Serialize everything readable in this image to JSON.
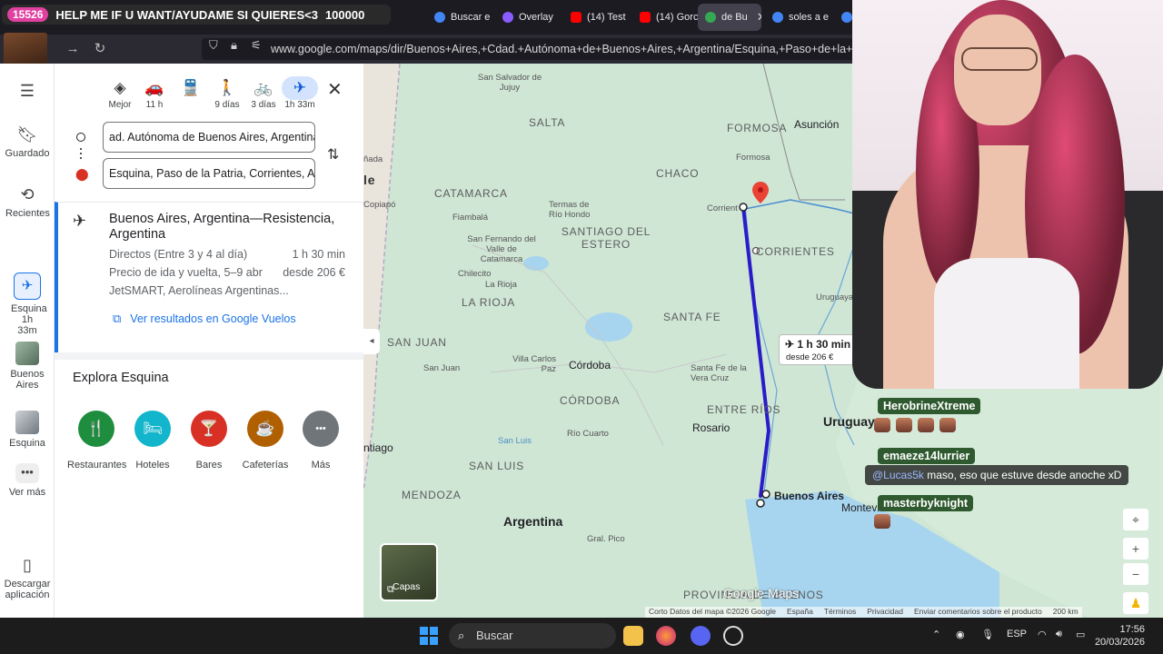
{
  "browser": {
    "tabs": [
      {
        "label": "HELP ME IF U WANT/AYUDAME SI QUIERES<3",
        "color": "#7a5cff"
      },
      {
        "label": "Buscar e",
        "color": "#4285f4"
      },
      {
        "label": "Overlay",
        "color": "#8a5cff"
      },
      {
        "label": "(14) Test",
        "color": "#ff0000"
      },
      {
        "label": "(14) Gorc",
        "color": "#ff0000"
      },
      {
        "label": "de Bu",
        "color": "#34a853"
      },
      {
        "label": "soles a e",
        "color": "#4285f4"
      },
      {
        "label": "cual",
        "color": "#4285f4"
      }
    ],
    "url": "www.google.com/maps/dir/Buenos+Aires,+Cdad.+Autónoma+de+Buenos+Aires,+Argentina/Esquina,+Paso+de+la+Patria,+C"
  },
  "stream": {
    "banner_count": "15526",
    "banner_text": "HELP ME IF U WANT/AYUDAME SI QUIERES<3",
    "goal": "100000",
    "cam_badge": "18"
  },
  "rail": {
    "items": [
      {
        "label": "Guardado",
        "icon": "bookmark-icon"
      },
      {
        "label": "Recientes",
        "icon": "history-icon"
      },
      {
        "label": "Esquina 1h 33m",
        "icon": "airplane-icon"
      },
      {
        "label": "Buenos Aires",
        "icon": "place-thumbnail"
      },
      {
        "label": "Esquina",
        "icon": "place-thumbnail"
      },
      {
        "label": "Ver más",
        "icon": "more-icon"
      },
      {
        "label": "Descargar aplicación",
        "icon": "phone-icon"
      }
    ]
  },
  "directions": {
    "modes": [
      {
        "label": "Mejor",
        "icon": "◈"
      },
      {
        "label": "11 h",
        "icon": "🚗"
      },
      {
        "label": "",
        "icon": "🚆"
      },
      {
        "label": "9 días",
        "icon": "🚶"
      },
      {
        "label": "3 días",
        "icon": "🚲"
      },
      {
        "label": "1h 33m",
        "icon": "✈"
      }
    ],
    "origin": "ad. Autónoma de Buenos Aires, Argentina",
    "destination": "Esquina, Paso de la Patria, Corrientes, Ar",
    "route": {
      "title": "Buenos Aires, Argentina—Resistencia, Argentina",
      "direct": "Directos (Entre 3 y 4 al día)",
      "duration": "1 h 30 min",
      "price_label": "Precio de ida y vuelta, 5–9 abr",
      "price": "desde 206 €",
      "airlines": "JetSMART, Aerolíneas Argentinas...",
      "flights_link": "Ver resultados en Google Vuelos"
    },
    "explore_title": "Explora Esquina",
    "categories": [
      {
        "label": "Restaurantes",
        "icon": "🍴",
        "color": "#1e8e3e"
      },
      {
        "label": "Hoteles",
        "icon": "🛏",
        "color": "#12b5cb"
      },
      {
        "label": "Bares",
        "icon": "🍸",
        "color": "#d93025"
      },
      {
        "label": "Cafeterías",
        "icon": "☕",
        "color": "#b06000"
      },
      {
        "label": "Más",
        "icon": "•••",
        "color": "#70757a"
      }
    ]
  },
  "map": {
    "labels": {
      "san_salvador": "San Salvador de Jujuy",
      "salta": "SALTA",
      "formosa_prov": "FORMOSA",
      "asuncion": "Asunción",
      "formosa": "Formosa",
      "chaco": "CHACO",
      "catamarca": "CATAMARCA",
      "corrientes_city": "Corrient",
      "copiapo": "Copiapó",
      "termas": "Termas de Río Hondo",
      "fiambala": "Fiambalá",
      "santiago": "SANTIAGO DEL ESTERO",
      "corrientes_prov": "CORRIENTES",
      "sfvc": "San Fernando del Valle de Catamarca",
      "chilecito": "Chilecito",
      "la_rioja_city": "La Rioja",
      "la_rioja": "LA RIOJA",
      "uruguaya": "Uruguaya",
      "santa_fe": "SANTA FE",
      "san_juan_prov": "SAN JUAN",
      "san_juan": "San Juan",
      "carlos_paz": "Villa Carlos Paz",
      "cordoba": "Córdoba",
      "santa_fe_city": "Santa Fe de la Vera Cruz",
      "cordoba_prov": "CÓRDOBA",
      "entre_rios": "ENTRE RÍOS",
      "uruguay": "Uruguay",
      "rosario": "Rosario",
      "rio_cuarto": "Río Cuarto",
      "santiago_cl": "ntiago",
      "san_luis_water": "San Luis",
      "san_luis": "SAN LUIS",
      "buenos_aires": "Buenos Aires",
      "montevideo": "Montevi",
      "mendoza": "MENDOZA",
      "argentina": "Argentina",
      "gral_pico": "Gral. Pico",
      "provincia_ba": "PROVINCIA DE BUENOS",
      "chile": "le",
      "banada": "ñada"
    },
    "callout_time": "1 h 30 min",
    "callout_price": "desde 206 €",
    "layers_label": "Capas",
    "watermark": "Google Maps",
    "attribution": [
      "Corto Datos del mapa ©2026 Google",
      "España",
      "Términos",
      "Privacidad",
      "Enviar comentarios sobre el producto",
      "200 km"
    ]
  },
  "chat": {
    "messages": [
      {
        "user": "HerobrineXtreme",
        "text": ""
      },
      {
        "user": "emaeze14lurrier",
        "mention": "@Lucas5k",
        "text": " maso, eso que estuve desde anoche xD"
      },
      {
        "user": "masterbyknight",
        "text": ""
      }
    ]
  },
  "taskbar": {
    "search_label": "Buscar",
    "lang": "ESP",
    "time": "17:56",
    "date": "20/03/2026"
  }
}
